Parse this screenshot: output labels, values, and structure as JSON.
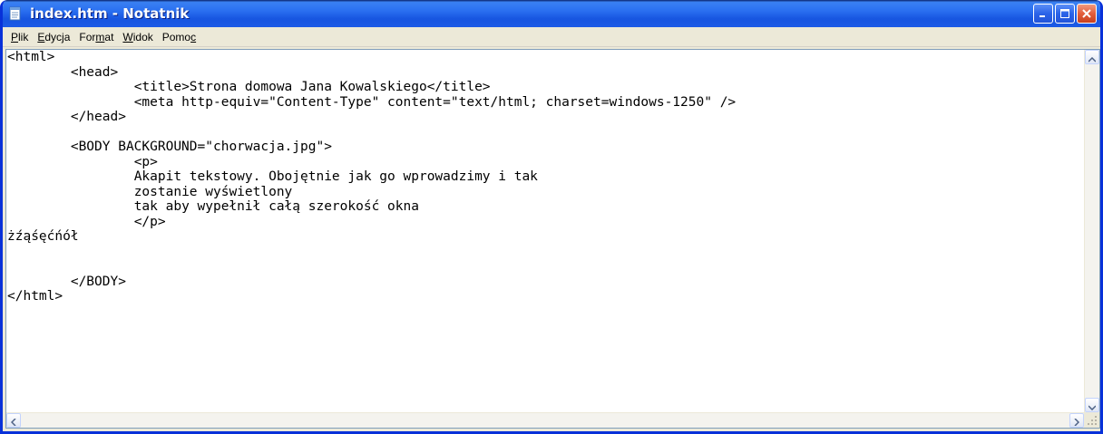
{
  "window": {
    "title": "index.htm - Notatnik"
  },
  "menu": [
    {
      "pre": "",
      "ul": "P",
      "post": "lik"
    },
    {
      "pre": "",
      "ul": "E",
      "post": "dycja"
    },
    {
      "pre": "For",
      "ul": "m",
      "post": "at"
    },
    {
      "pre": "",
      "ul": "W",
      "post": "idok"
    },
    {
      "pre": "Pomo",
      "ul": "c",
      "post": ""
    }
  ],
  "editor": {
    "lines": [
      "<html>",
      "\t<head>",
      "\t\t<title>Strona domowa Jana Kowalskiego</title>",
      "\t\t<meta http-equiv=\"Content-Type\" content=\"text/html; charset=windows-1250\" />",
      "\t</head>",
      "",
      "\t<BODY BACKGROUND=\"chorwacja.jpg\">",
      "\t\t<p>",
      "\t\tAkapit tekstowy. Obojętnie jak go wprowadzimy i tak",
      "\t\tzostanie wyświetlony",
      "\t\ttak aby wypełnił całą szerokość okna",
      "\t\t</p>",
      "żźąśęćńół",
      "",
      "",
      "\t</BODY>",
      "</html>"
    ]
  },
  "colors": {
    "titlebar": "#2a6ff0",
    "close_button": "#e35e3c",
    "chrome": "#ece9d8"
  },
  "icons": {
    "app": "notepad-icon",
    "minimize": "minimize-icon",
    "maximize": "maximize-icon",
    "close": "close-icon"
  }
}
